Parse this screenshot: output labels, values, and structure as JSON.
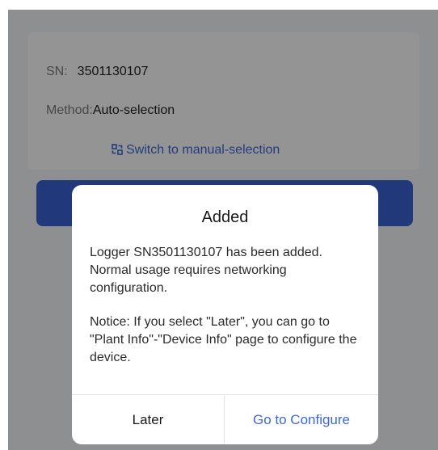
{
  "device_info": {
    "sn_label": "SN:",
    "sn_value": "3501130107",
    "method_label": "Method:",
    "method_value": "Auto-selection",
    "switch_link": "Switch to manual-selection"
  },
  "dialog": {
    "title": "Added",
    "message": "Logger SN3501130107 has been added. Normal usage requires networking configuration.",
    "notice": "Notice: If you select \"Later\", you can go to \"Plant Info\"-\"Device Info\" page to configure the device.",
    "later_label": "Later",
    "configure_label": "Go to Configure"
  },
  "colors": {
    "accent": "#3a62d4",
    "link": "#3c68d6"
  },
  "icons": {
    "switch": "switch-swap-icon"
  }
}
